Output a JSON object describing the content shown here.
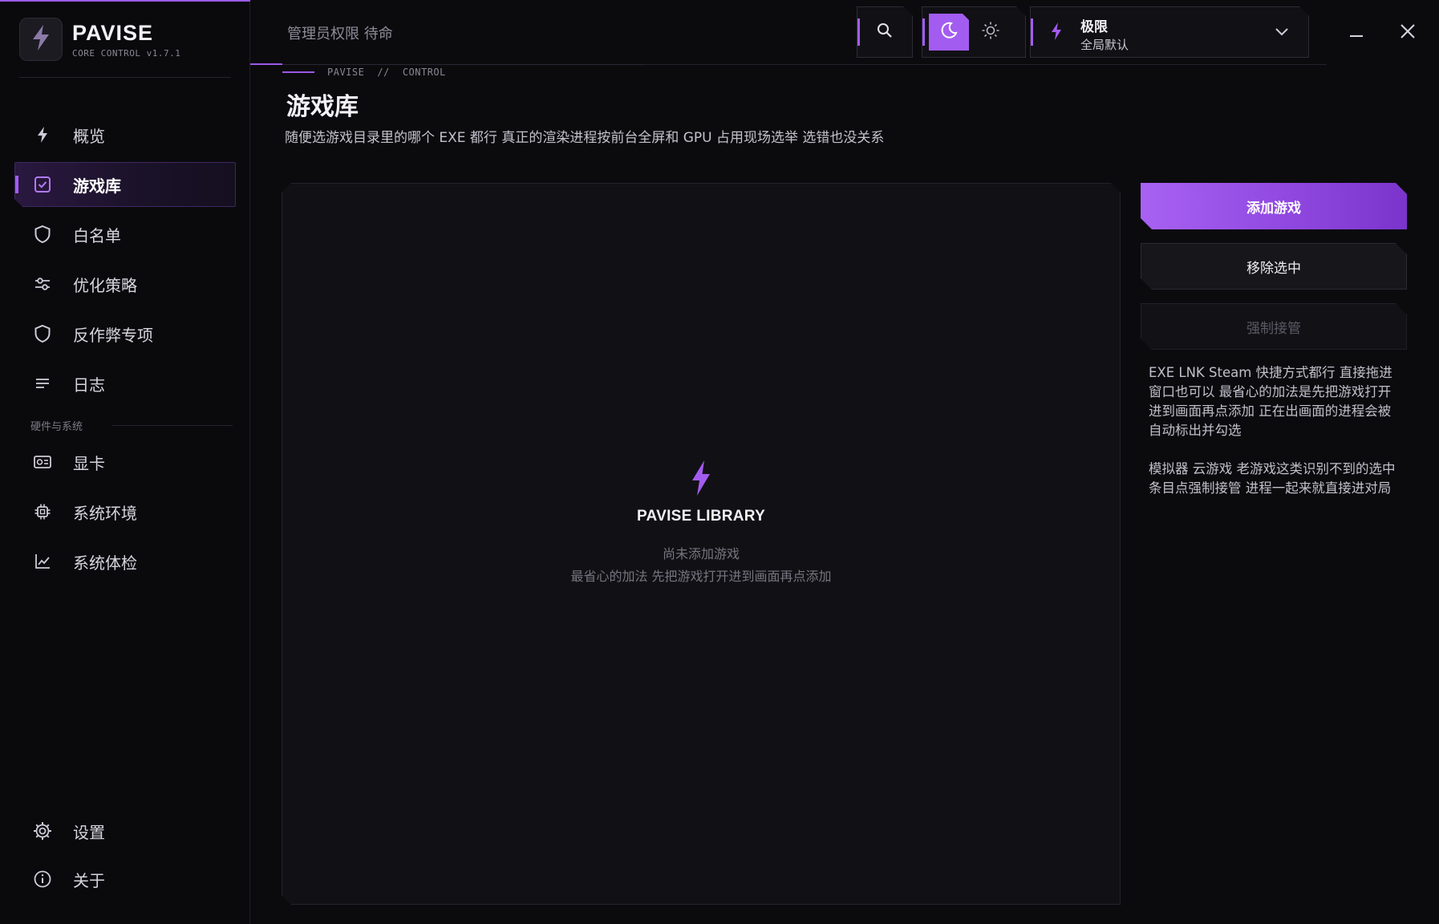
{
  "brand": {
    "name": "PAVISE",
    "version": "CORE CONTROL v1.7.1"
  },
  "sidebar": {
    "items": [
      {
        "label": "概览",
        "icon": "bolt-icon"
      },
      {
        "label": "游戏库",
        "icon": "checkbox-icon",
        "active": true
      },
      {
        "label": "白名单",
        "icon": "shield-icon"
      },
      {
        "label": "优化策略",
        "icon": "sliders-icon"
      },
      {
        "label": "反作弊专项",
        "icon": "shield-icon"
      },
      {
        "label": "日志",
        "icon": "list-icon"
      }
    ],
    "section_label": "硬件与系统",
    "hardware_items": [
      {
        "label": "显卡",
        "icon": "gpu-icon"
      },
      {
        "label": "系统环境",
        "icon": "chip-icon"
      },
      {
        "label": "系统体检",
        "icon": "chart-icon"
      }
    ],
    "bottom_items": [
      {
        "label": "设置",
        "icon": "gear-icon"
      },
      {
        "label": "关于",
        "icon": "info-icon"
      }
    ]
  },
  "topbar": {
    "status": "管理员权限 待命",
    "profile_title": "极限",
    "profile_subtitle": "全局默认"
  },
  "breadcrumb": {
    "root": "PAVISE",
    "separator": "//",
    "current": "CONTROL"
  },
  "page": {
    "title": "游戏库",
    "description": "随便选游戏目录里的哪个 EXE 都行 真正的渲染进程按前台全屏和 GPU 占用现场选举 选错也没关系"
  },
  "library": {
    "empty_title": "PAVISE LIBRARY",
    "empty_line1": "尚未添加游戏",
    "empty_line2": "最省心的加法 先把游戏打开进到画面再点添加"
  },
  "actions": {
    "add": "添加游戏",
    "remove": "移除选中",
    "force": "强制接管"
  },
  "help": {
    "p1": "EXE LNK Steam 快捷方式都行 直接拖进窗口也可以 最省心的加法是先把游戏打开进到画面再点添加 正在出画面的进程会被自动标出并勾选",
    "p2": "模拟器 云游戏 老游戏这类识别不到的选中条目点强制接管 进程一起来就直接进对局"
  },
  "colors": {
    "accent": "#a35cf0",
    "background": "#0b0b0e",
    "panel": "#111115"
  }
}
